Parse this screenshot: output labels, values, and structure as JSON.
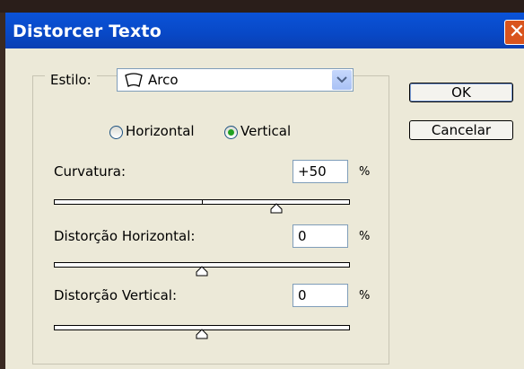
{
  "dialog": {
    "title": "Distorcer Texto",
    "close_glyph": "✕"
  },
  "style": {
    "label": "Estilo:",
    "selected": "Arco",
    "icon": "arc-icon"
  },
  "orientation": {
    "horizontal_label": "Horizontal",
    "vertical_label": "Vertical",
    "selected": "Vertical"
  },
  "curvature": {
    "label": "Curvatura:",
    "value": "+50",
    "unit": "%",
    "slider_percent": 50
  },
  "hdistort": {
    "label": "Distorção Horizontal:",
    "value": "0",
    "unit": "%",
    "slider_percent": 0
  },
  "vdistort": {
    "label": "Distorção Vertical:",
    "value": "0",
    "unit": "%",
    "slider_percent": 0
  },
  "buttons": {
    "ok": "OK",
    "cancel": "Cancelar"
  },
  "colors": {
    "title_bar": "#0848c6",
    "close": "#d9541d",
    "face": "#ece9d8",
    "radio_dot": "#21a121"
  }
}
